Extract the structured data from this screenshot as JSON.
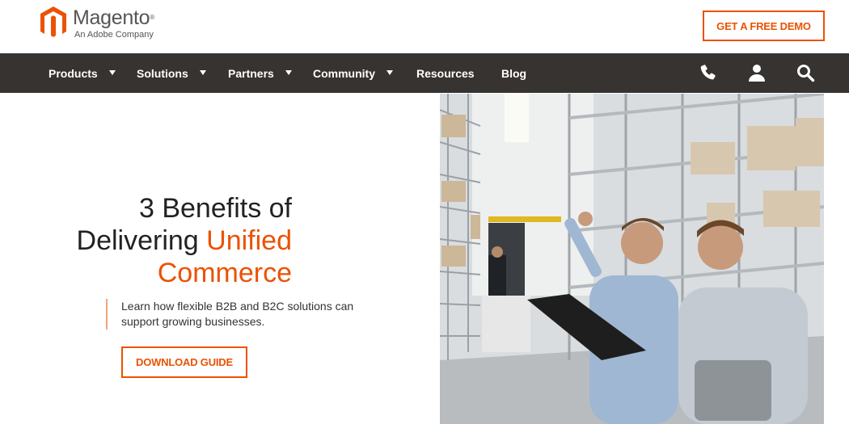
{
  "header": {
    "logo_word": "Magento",
    "logo_tm": "®",
    "logo_sub": "An Adobe Company",
    "demo_label": "GET A FREE DEMO"
  },
  "nav": {
    "items": [
      {
        "label": "Products",
        "has_caret": true
      },
      {
        "label": "Solutions",
        "has_caret": true
      },
      {
        "label": "Partners",
        "has_caret": true
      },
      {
        "label": "Community",
        "has_caret": true
      },
      {
        "label": "Resources",
        "has_caret": false
      },
      {
        "label": "Blog",
        "has_caret": false
      }
    ],
    "icons": [
      "phone-icon",
      "user-icon",
      "search-icon"
    ]
  },
  "hero": {
    "title_line1": "3 Benefits of",
    "title_line2_plain": "Delivering ",
    "title_line2_highlight": "Unified",
    "title_line3": "Commerce",
    "description": "Learn how flexible B2B and B2C solutions can support growing businesses.",
    "cta_label": "DOWNLOAD GUIDE"
  },
  "colors": {
    "accent": "#eb5202",
    "nav_bg": "#373330",
    "text": "#222222"
  }
}
